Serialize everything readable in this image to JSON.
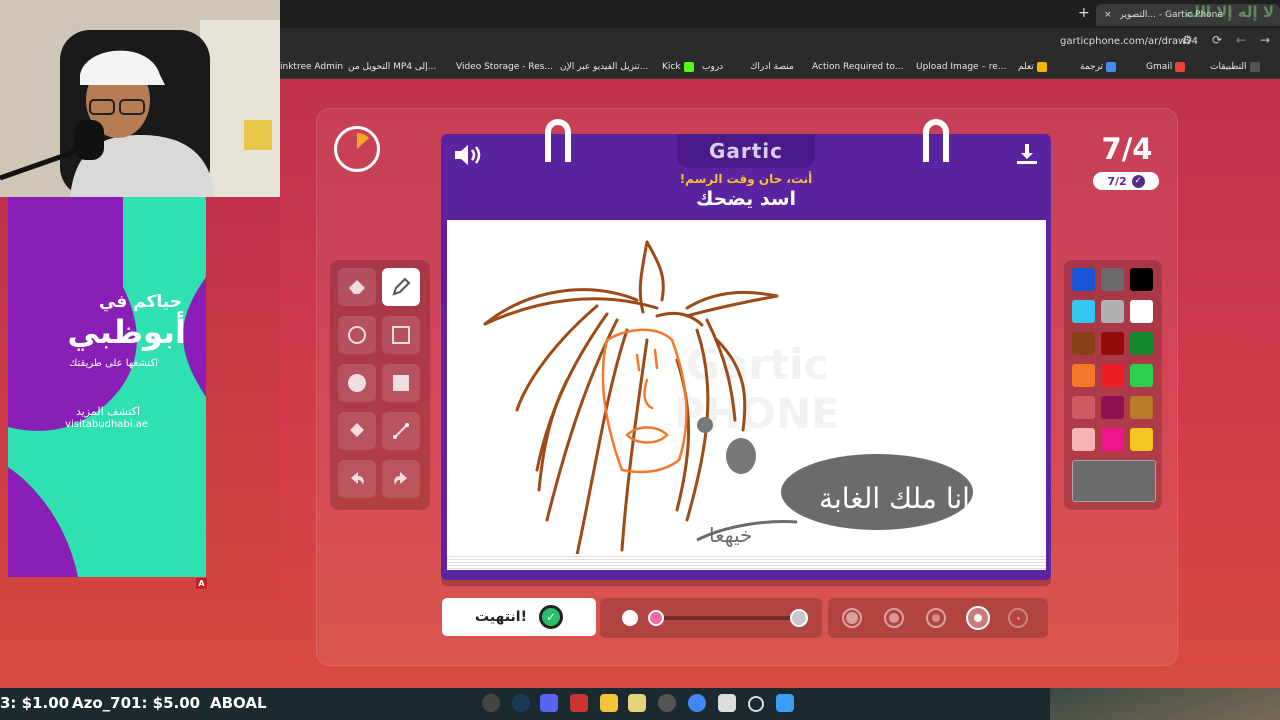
{
  "browser": {
    "tabs": [
      {
        "title": "Gartic Phone - ...التصوير"
      },
      {
        "title": "لا إله إلا الله"
      }
    ],
    "new_tab_symbol": "+",
    "close_symbol": "×",
    "url": "garticphone.com/ar/draw?4",
    "bookmarks": [
      {
        "label": "التطبيقات"
      },
      {
        "label": "Gmail"
      },
      {
        "label": "ترجمة"
      },
      {
        "label": "تعلم"
      },
      {
        "label": "Upload Image – re..."
      },
      {
        "label": "Action Required to..."
      },
      {
        "label": "منصة ادراك"
      },
      {
        "label": "دروب"
      },
      {
        "label": "Kick"
      },
      {
        "label": "تنزيل الفيديو عبر الإن..."
      },
      {
        "label": "Video Storage - Res..."
      },
      {
        "label": "التحويل من MP4 إلى..."
      },
      {
        "label": "inktree Admin"
      }
    ]
  },
  "ad": {
    "headline": "حياكم في",
    "brand": "أبوظبي",
    "tagline": "اكتشفها على طريقتك",
    "cta": "اكتشف المزيد",
    "url": "visitabudhabi.ae",
    "badge": "A"
  },
  "game": {
    "logo": "Gartic",
    "round": "7/4",
    "done_count": "7/2",
    "instruction": "أنت، حان وقت الرسم!",
    "prompt": "اسد يضحك",
    "done_label": "انتهيت!",
    "watermark": "Gartic PHONE",
    "drawing_text_1": "انا ملك الغابة",
    "drawing_text_2": "خيهعا",
    "palette": [
      "#1b56d9",
      "#6b6b6b",
      "#000000",
      "#33c6f0",
      "#b0b0b0",
      "#ffffff",
      "#8a4016",
      "#930c0c",
      "#138a2f",
      "#f5782a",
      "#ee1c24",
      "#2bd14d",
      "#cc5b62",
      "#8e0f54",
      "#b87b2a",
      "#f8b3b3",
      "#ef168c",
      "#f4c623"
    ],
    "selected_color": "#6b6b6b",
    "tools": [
      {
        "icon": "pencil-icon",
        "selected": true
      },
      {
        "icon": "eraser-icon",
        "selected": false
      },
      {
        "icon": "rect-outline-icon",
        "selected": false
      },
      {
        "icon": "circle-outline-icon",
        "selected": false
      },
      {
        "icon": "rect-fill-icon",
        "selected": false
      },
      {
        "icon": "circle-fill-icon",
        "selected": false
      },
      {
        "icon": "line-icon",
        "selected": false
      },
      {
        "icon": "bucket-icon",
        "selected": false
      },
      {
        "icon": "undo-icon",
        "selected": false
      },
      {
        "icon": "redo-icon",
        "selected": false
      }
    ],
    "opacity_selected": 2
  },
  "taskbar": {
    "ticker_1": "3: $1.00",
    "ticker_2": "Azo_701: $5.00",
    "ticker_3": "ABOAL"
  }
}
